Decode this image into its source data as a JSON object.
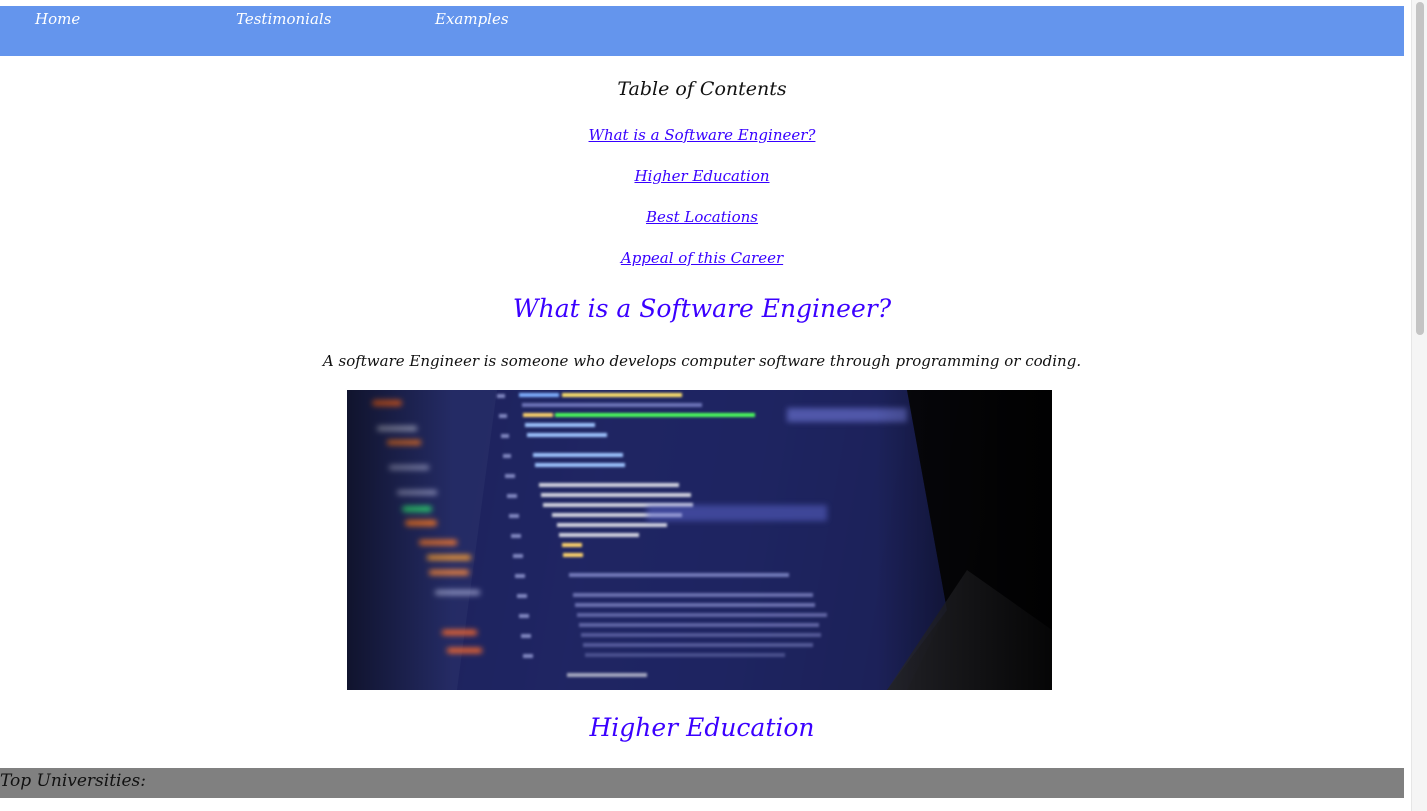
{
  "nav": {
    "home": "Home",
    "testimonials": "Testimonials",
    "examples": "Examples",
    "background_color": "#6495ed"
  },
  "toc": {
    "title": "Table of Contents",
    "links": [
      "What is a Software Engineer?",
      "Higher Education",
      "Best Locations",
      "Appeal of this Career"
    ],
    "link_color": "#3700ff"
  },
  "sections": {
    "software_engineer": {
      "heading": "What is a Software Engineer?",
      "text": "A software Engineer is someone who develops computer software through programming or coding.",
      "image_subject": "blurred laptop screen with code editor"
    },
    "higher_education": {
      "heading": "Higher Education"
    }
  },
  "universities_bar": {
    "label": "Top Universities:",
    "background_color": "#808080"
  }
}
